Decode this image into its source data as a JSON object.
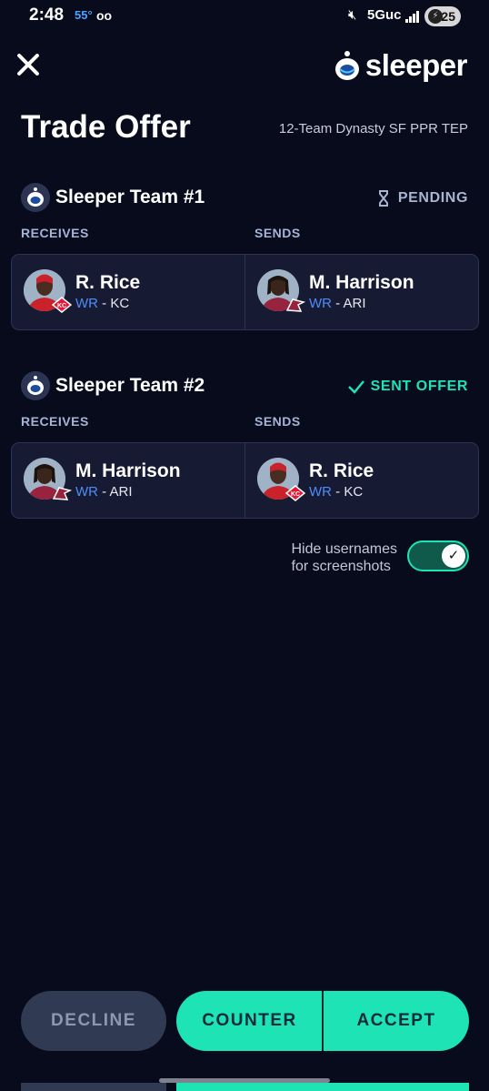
{
  "status_bar": {
    "time": "2:48",
    "temperature": "55°",
    "voicemail_icon": "voicemail-icon",
    "mute_icon": "mute-icon",
    "network": "5Guc",
    "battery": "25"
  },
  "header": {
    "close_icon": "close-icon",
    "brand": "sleeper",
    "title": "Trade Offer",
    "league": "12-Team Dynasty SF PPR TEP"
  },
  "teams": [
    {
      "name": "Sleeper Team #1",
      "status": "PENDING",
      "status_icon": "hourglass-icon",
      "receives_label": "RECEIVES",
      "sends_label": "SENDS",
      "receives": {
        "name": "R. Rice",
        "position": "WR",
        "team": "- KC"
      },
      "sends": {
        "name": "M. Harrison",
        "position": "WR",
        "team": "- ARI"
      }
    },
    {
      "name": "Sleeper Team #2",
      "status": "SENT OFFER",
      "status_icon": "checkmark-icon",
      "receives_label": "RECEIVES",
      "sends_label": "SENDS",
      "receives": {
        "name": "M. Harrison",
        "position": "WR",
        "team": "- ARI"
      },
      "sends": {
        "name": "R. Rice",
        "position": "WR",
        "team": "- KC"
      }
    }
  ],
  "toggle": {
    "label_line1": "Hide usernames",
    "label_line2": "for screenshots",
    "checked": true
  },
  "actions": {
    "decline": "DECLINE",
    "counter": "COUNTER",
    "accept": "ACCEPT"
  },
  "colors": {
    "background": "#070b1c",
    "accent": "#1ee3b4",
    "position_blue": "#4f8cf7",
    "card": "#161b33"
  }
}
